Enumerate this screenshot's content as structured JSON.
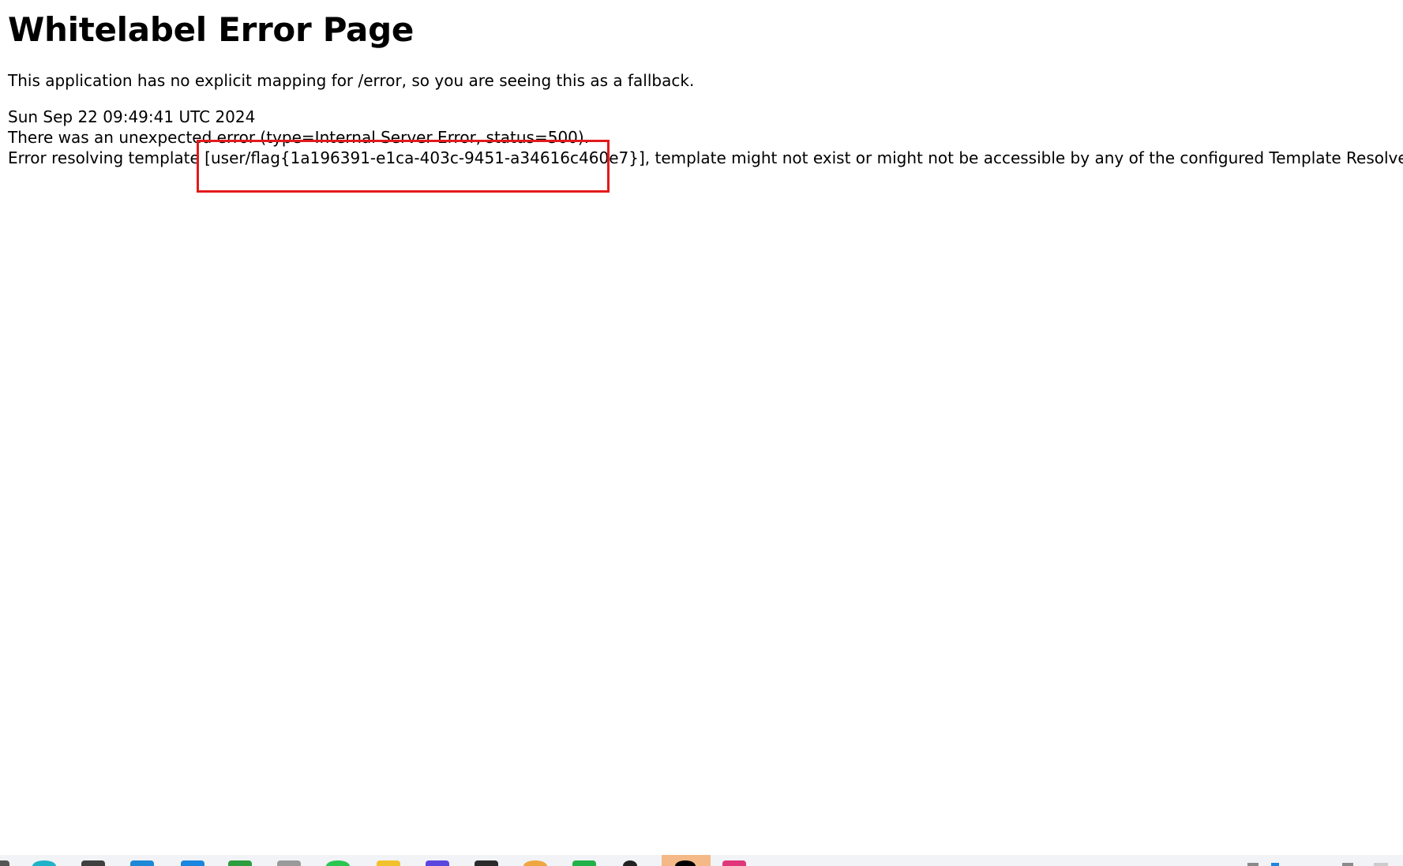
{
  "page": {
    "title": "Whitelabel Error Page",
    "explanation": "This application has no explicit mapping for /error, so you are seeing this as a fallback.",
    "timestamp": "Sun Sep 22 09:49:41 UTC 2024",
    "error_summary": "There was an unexpected error (type=Internal Server Error, status=500).",
    "error_detail": "Error resolving template [user/flag{1a196391-e1ca-403c-9451-a34616c460e7}], template might not exist or might not be accessible by any of the configured Template Resolvers"
  },
  "annotation": {
    "highlight_color": "#e21b1b"
  },
  "taskbar": {
    "background_color": "#f1f3f6",
    "active_item_color": "#f5b987",
    "apps": [
      {
        "icon": "app-icon-partial",
        "color": "#555555"
      },
      {
        "icon": "edge-browser-icon",
        "color": "#1fb3c9"
      },
      {
        "icon": "file-manager-icon",
        "color": "#404040"
      },
      {
        "icon": "vscode-icon",
        "color": "#1e88d6"
      },
      {
        "icon": "blue-app-icon",
        "color": "#1a86e0"
      },
      {
        "icon": "green-app-icon",
        "color": "#2e9d3d"
      },
      {
        "icon": "gray-app-icon",
        "color": "#9a9a9a"
      },
      {
        "icon": "wechat-icon",
        "color": "#2bc551"
      },
      {
        "icon": "yellow-app-icon",
        "color": "#f2c12e"
      },
      {
        "icon": "purple-app-icon",
        "color": "#5b47e0"
      },
      {
        "icon": "terminal-icon",
        "color": "#2b2b2b"
      },
      {
        "icon": "orange-app-icon",
        "color": "#f0a640"
      },
      {
        "icon": "chat-app-icon",
        "color": "#23b24a"
      },
      {
        "icon": "github-icon",
        "color": "#222222"
      },
      {
        "icon": "qq-icon-active",
        "color": "#000000"
      },
      {
        "icon": "pink-app-icon",
        "color": "#e0367a"
      }
    ]
  }
}
